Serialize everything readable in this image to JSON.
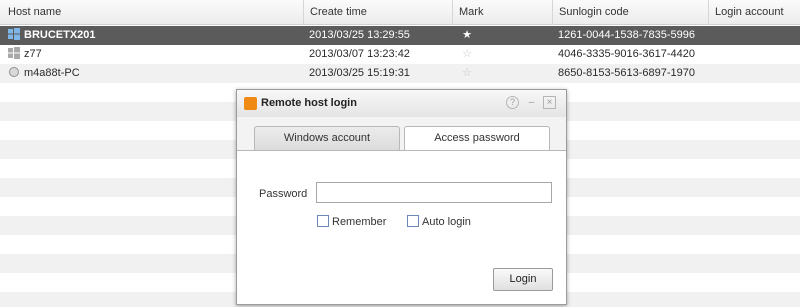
{
  "table": {
    "headers": [
      "Host name",
      "Create time",
      "Mark",
      "Sunlogin code",
      "Login account"
    ],
    "rows": [
      {
        "host": "BRUCETX201",
        "icon": "windows-icon",
        "created": "2013/03/25 13:29:55",
        "marked": true,
        "mark_glyph": "★",
        "code": "1261-0044-1538-7835-5996",
        "account": ""
      },
      {
        "host": "z77",
        "icon": "windows-icon",
        "created": "2013/03/07 13:23:42",
        "marked": false,
        "mark_glyph": "☆",
        "code": "4046-3335-9016-3617-4420",
        "account": ""
      },
      {
        "host": "m4a88t-PC",
        "icon": "offline-dot-icon",
        "created": "2013/03/25 15:19:31",
        "marked": false,
        "mark_glyph": "☆",
        "code": "8650-8153-5613-6897-1970",
        "account": ""
      }
    ]
  },
  "dialog": {
    "title": "Remote host login",
    "help_glyph": "?",
    "minimize_glyph": "–",
    "close_glyph": "×",
    "tabs": [
      "Windows account",
      "Access password"
    ],
    "active_tab": 1,
    "password_label": "Password",
    "password_value": "",
    "remember_label": "Remember",
    "remember_checked": false,
    "autologin_label": "Auto login",
    "autologin_checked": false,
    "login_label": "Login"
  },
  "colors": {
    "selected_row": "#5b5b5b",
    "brand_orange": "#f08a14",
    "stripe": "#f1f1f1"
  }
}
